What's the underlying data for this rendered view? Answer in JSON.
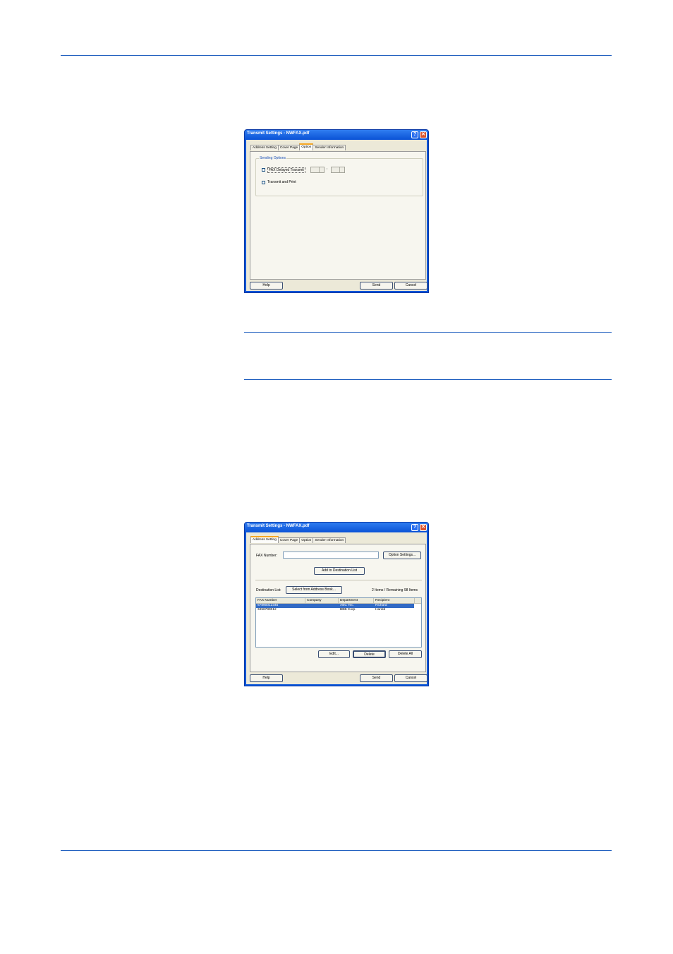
{
  "dialog1": {
    "title": "Transmit Settings - NWFAX.pdf",
    "help_glyph": "?",
    "close_glyph": "✕",
    "tabs": [
      "Address Setting",
      "Cover Page",
      "Option",
      "Sender Information"
    ],
    "active_tab": "Option",
    "group_title": "Sending Options",
    "delayed_label": "FAX Delayed Transmit",
    "delayed_checked": false,
    "spin_separator": ":",
    "print_label": "Transmit and Print",
    "print_checked": false,
    "help_button": "Help",
    "send_button": "Send",
    "cancel_button": "Cancel"
  },
  "dialog2": {
    "title": "Transmit Settings - NWFAX.pdf",
    "help_glyph": "?",
    "close_glyph": "✕",
    "tabs": [
      "Address Setting",
      "Cover Page",
      "Option",
      "Sender Information"
    ],
    "active_tab": "Address Setting",
    "fax_number_label": "FAX Number:",
    "fax_number_value": "",
    "option_settings_button": "Option Settings...",
    "add_button": "Add to Destination List",
    "destination_label": "Destination List:",
    "address_book_button": "Select from Address Book...",
    "count_text": "2 Items / Remaining 98 Items",
    "columns": [
      "FAX Number",
      "Company",
      "Department",
      "Recipient"
    ],
    "rows": [
      {
        "fax": "67890012345",
        "company": "",
        "department": "ABC Tec.",
        "recipient": "Richard",
        "selected": true
      },
      {
        "fax": "3456789012",
        "company": "",
        "department": "BBB Corp.",
        "recipient": "Harold",
        "selected": false
      }
    ],
    "edit_button": "Edit...",
    "delete_button": "Delete",
    "delete_all_button": "Delete All",
    "help_button": "Help",
    "send_button": "Send",
    "cancel_button": "Cancel"
  }
}
